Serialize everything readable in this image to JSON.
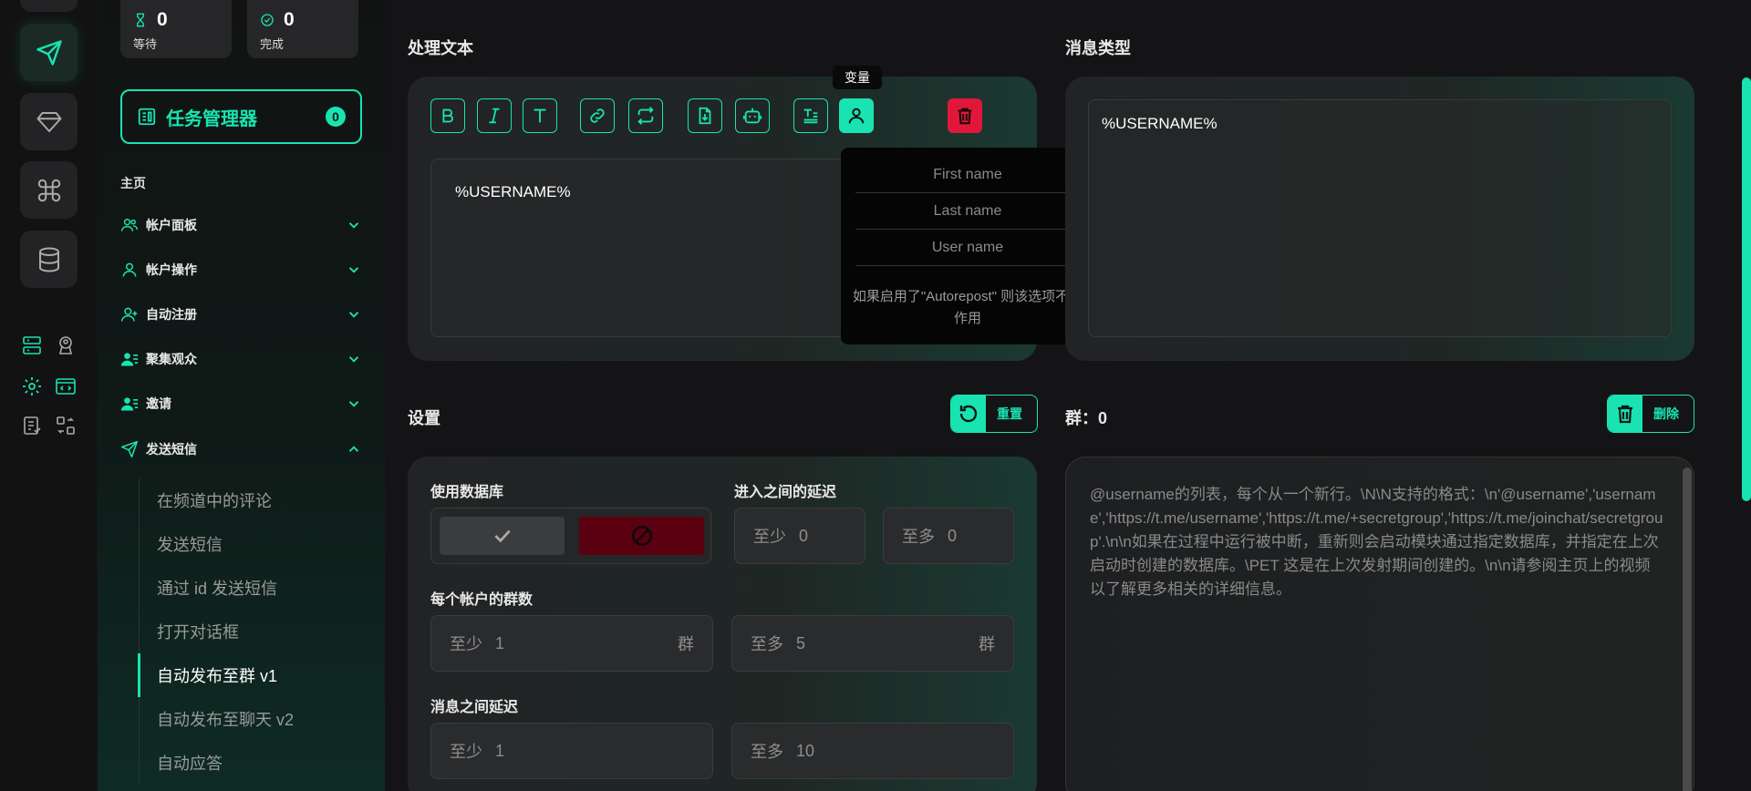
{
  "stats": [
    {
      "icon": "hourglass-icon",
      "value": "0",
      "label": "等待"
    },
    {
      "icon": "check-circle-icon",
      "value": "0",
      "label": "完成"
    }
  ],
  "task_manager": {
    "label": "任务管理器",
    "count": "0"
  },
  "nav": {
    "home": "主页",
    "items": [
      {
        "label": "帐户面板",
        "icon": "users-icon",
        "expanded": false
      },
      {
        "label": "帐户操作",
        "icon": "user-icon",
        "expanded": false
      },
      {
        "label": "自动注册",
        "icon": "user-plus-icon",
        "expanded": false
      },
      {
        "label": "聚集观众",
        "icon": "user-list-icon",
        "expanded": false
      },
      {
        "label": "邀请",
        "icon": "user-list-icon",
        "expanded": false
      },
      {
        "label": "发送短信",
        "icon": "send-icon",
        "expanded": true
      }
    ],
    "sub_items": [
      "在频道中的评论",
      "发送短信",
      "通过 id 发送短信",
      "打开对话框",
      "自动发布至群 v1",
      "自动发布至聊天 v2",
      "自动应答"
    ],
    "active_sub": 4
  },
  "text_section": {
    "title": "处理文本",
    "tooltip": "变量",
    "content": "%USERNAME%",
    "variables": [
      "First name",
      "Last name",
      "User name"
    ],
    "variables_note": "如果启用了\"Autorepost\" 则该选项不起作用"
  },
  "message_type": {
    "title": "消息类型",
    "content": "%USERNAME%"
  },
  "settings": {
    "title": "设置",
    "reset_label": "重置",
    "use_db_label": "使用数据库",
    "join_delay_label": "进入之间的延迟",
    "join_delay": {
      "min_label": "至少",
      "min": "0",
      "max_label": "至多",
      "max": "0"
    },
    "groups_per_account_label": "每个帐户的群数",
    "groups_per_account": {
      "min_label": "至少",
      "min": "1",
      "max_label": "至多",
      "max": "5",
      "unit": "群"
    },
    "msg_delay_label": "消息之间延迟",
    "msg_delay": {
      "min_label": "至少",
      "min": "1",
      "max_label": "至多",
      "max": "10"
    }
  },
  "groups": {
    "title": "群：0",
    "delete_label": "删除",
    "placeholder": "@username的列表，每个从一个新行。\\N\\N支持的格式：\\n'@username','username','https://t.me/username','https://t.me/+secretgroup','https://t.me/joinchat/secretgroup'.\\n\\n如果在过程中运行被中断，重新则会启动模块通过指定数据库，并指定在上次启动时创建的数据库。\\PET 这是在上次发射期间创建的。\\n\\n请参阅主页上的视频以了解更多相关的详细信息。"
  },
  "colors": {
    "accent": "#19e3b1",
    "danger": "#e0173a"
  }
}
